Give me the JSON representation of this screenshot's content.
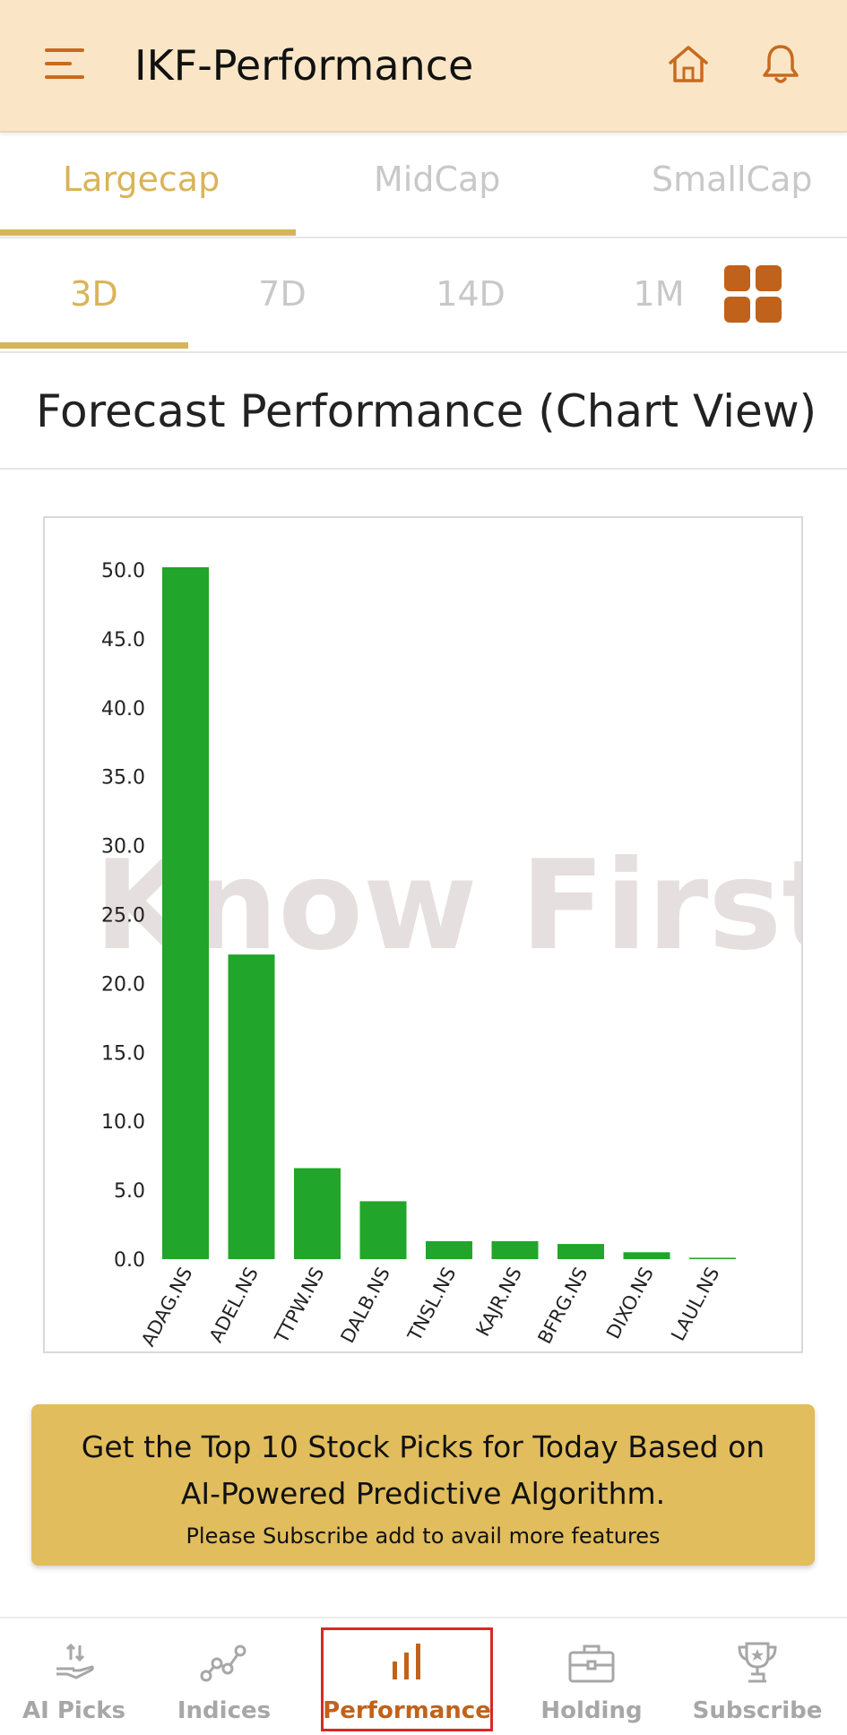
{
  "header": {
    "title": "IKF-Performance",
    "menu_icon": "hamburger-menu-icon",
    "home_icon": "home-icon",
    "bell_icon": "bell-icon",
    "accent_color": "#c86a1f",
    "background": "#fae6c6"
  },
  "cap_tabs": [
    {
      "label": "Largecap",
      "active": true
    },
    {
      "label": "MidCap",
      "active": false
    },
    {
      "label": "SmallCap",
      "active": false
    }
  ],
  "period_tabs": [
    {
      "label": "3D",
      "active": true
    },
    {
      "label": "7D",
      "active": false
    },
    {
      "label": "14D",
      "active": false
    },
    {
      "label": "1M",
      "active": false
    }
  ],
  "view_toggle_icon": "grid-view-icon",
  "section_title": "Forecast Performance (Chart View)",
  "chart_data": {
    "type": "bar",
    "categories": [
      "ADAG.NS",
      "ADEL.NS",
      "TTPW.NS",
      "DALB.NS",
      "TNSL.NS",
      "KAJR.NS",
      "BFRG.NS",
      "DIXO.NS",
      "LAUL.NS"
    ],
    "values": [
      50.2,
      22.1,
      6.6,
      4.2,
      1.3,
      1.3,
      1.1,
      0.5,
      0.1
    ],
    "ylim": [
      0,
      50
    ],
    "yticks": [
      "0.0",
      "5.0",
      "10.0",
      "15.0",
      "20.0",
      "25.0",
      "30.0",
      "35.0",
      "40.0",
      "45.0",
      "50.0"
    ],
    "bar_color": "#21a52a",
    "watermark": "I Know First",
    "grid": false,
    "title": "",
    "xlabel": "",
    "ylabel": ""
  },
  "banner": {
    "headline": "Get the Top 10 Stock Picks for Today Based on AI-Powered Predictive Algorithm.",
    "subtext": "Please  Subscribe add to avail more features",
    "color": "#e1bd5d"
  },
  "bottom_nav": [
    {
      "label": "AI Picks",
      "icon": "ai-picks-icon",
      "active": false
    },
    {
      "label": "Indices",
      "icon": "indices-icon",
      "active": false
    },
    {
      "label": "Performance",
      "icon": "performance-icon",
      "active": true
    },
    {
      "label": "Holding",
      "icon": "briefcase-icon",
      "active": false
    },
    {
      "label": "Subscribe",
      "icon": "trophy-icon",
      "active": false
    }
  ]
}
